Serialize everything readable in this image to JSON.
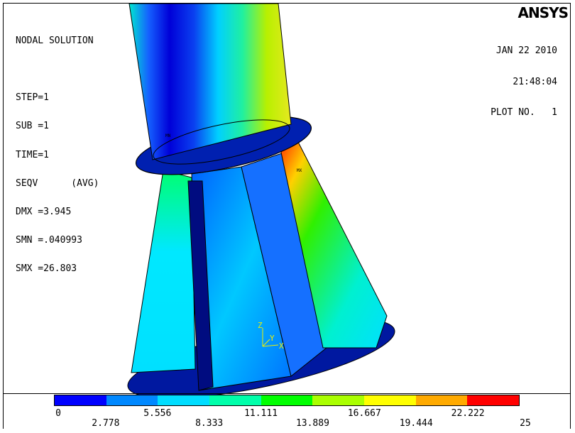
{
  "header_left": {
    "title": "NODAL SOLUTION",
    "lines": [
      "STEP=1",
      "SUB =1",
      "TIME=1",
      "SEQV      (AVG)",
      "DMX =3.945",
      "SMN =.040993",
      "SMX =26.803"
    ]
  },
  "header_right": {
    "logo_part1": "ANSYS",
    "logo_part2": "",
    "date": "JAN 22 2010",
    "time": "21:48:04",
    "plot_no": "PLOT NO.   1"
  },
  "markers": {
    "min_label": "MN",
    "max_label": "MX"
  },
  "axis_triad": {
    "z": "Z",
    "y": "Y",
    "x": "X"
  },
  "legend": {
    "colors": [
      "#0000ff",
      "#0088ff",
      "#00ddff",
      "#00ffaa",
      "#00ff00",
      "#aaff00",
      "#ffff00",
      "#ffaa00",
      "#ff0000"
    ],
    "ticks_top": [
      "0",
      "5.556",
      "11.111",
      "16.667",
      "22.222"
    ],
    "ticks_bottom": [
      "2.778",
      "8.333",
      "13.889",
      "19.444",
      "25"
    ]
  }
}
